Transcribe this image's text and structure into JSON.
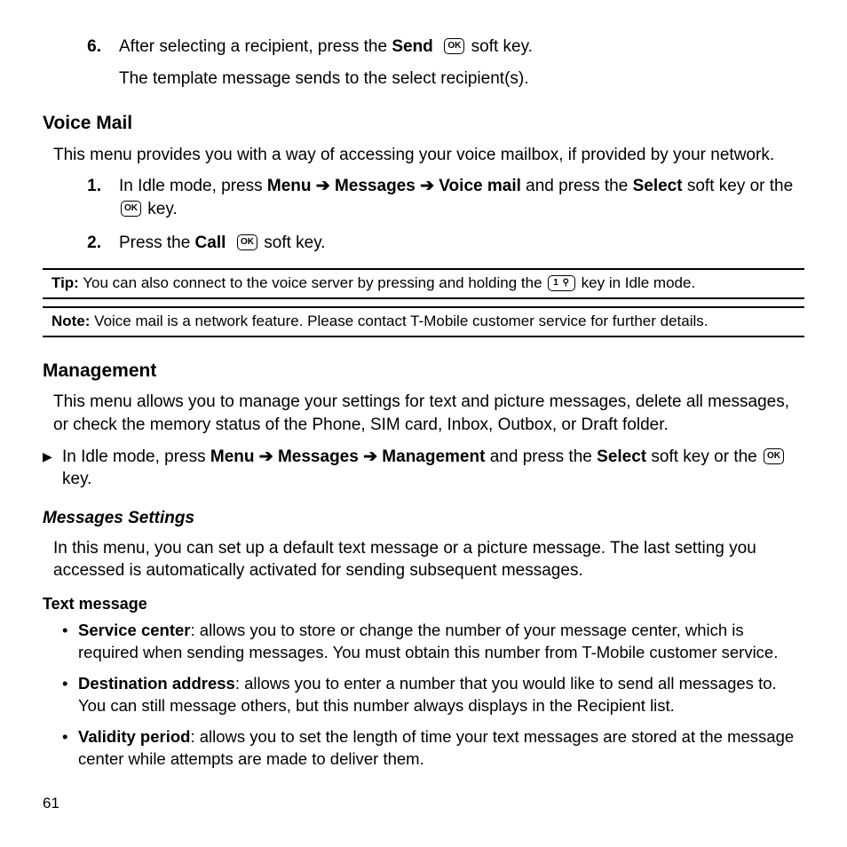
{
  "step6": {
    "num": "6.",
    "line1_a": "After selecting a recipient, press the ",
    "line1_b": "Send",
    "line1_c": " soft key.",
    "line2": "The template message sends to the select recipient(s)."
  },
  "voiceMail": {
    "heading": "Voice Mail",
    "intro": "This menu provides you with a way of accessing your voice mailbox, if provided by your network.",
    "s1": {
      "num": "1.",
      "a": "In Idle mode, press ",
      "b": "Menu",
      "arr": " ➔ ",
      "c": "Messages",
      "d": "Voice mail",
      "e": " and press the ",
      "f": "Select",
      "g": " soft key or the ",
      "h": " key."
    },
    "s2": {
      "num": "2.",
      "a": "Press the ",
      "b": "Call",
      "c": " soft key."
    },
    "tip": {
      "label": "Tip:",
      "a": " You can also connect to the voice server by pressing and holding the ",
      "b": " key in Idle mode."
    },
    "note": {
      "label": "Note:",
      "text": " Voice mail is a network feature. Please contact T-Mobile customer service for further details."
    }
  },
  "management": {
    "heading": "Management",
    "intro": "This menu allows you to manage your settings for text and picture messages, delete all messages, or check the memory status of the Phone, SIM card, Inbox, Outbox, or Draft folder.",
    "nav": {
      "a": "In Idle mode, press ",
      "b": "Menu",
      "arr": " ➔ ",
      "c": "Messages",
      "d": "Management",
      "e": " and press the ",
      "f": "Select",
      "g": " soft key or the ",
      "h": " key."
    },
    "msgset": {
      "heading": "Messages Settings",
      "intro": "In this menu, you can set up a default text message or a picture message. The last setting you accessed is automatically activated for sending subsequent messages."
    },
    "txt": {
      "heading": "Text message",
      "b1": {
        "label": "Service center",
        "rest": ": allows you to store or change the number of your message center, which is required when sending messages. You must obtain this number from T-Mobile customer service."
      },
      "b2": {
        "label": "Destination address",
        "rest": ": allows you to enter a number that you would like to send all messages to. You can still message others, but this number always displays in the Recipient list."
      },
      "b3": {
        "label": "Validity period",
        "rest": ": allows you to set the length of time your text messages are stored at the message center while attempts are made to deliver them."
      }
    }
  },
  "icons": {
    "ok": "OK",
    "one": "1 ⚲"
  },
  "pageNumber": "61"
}
